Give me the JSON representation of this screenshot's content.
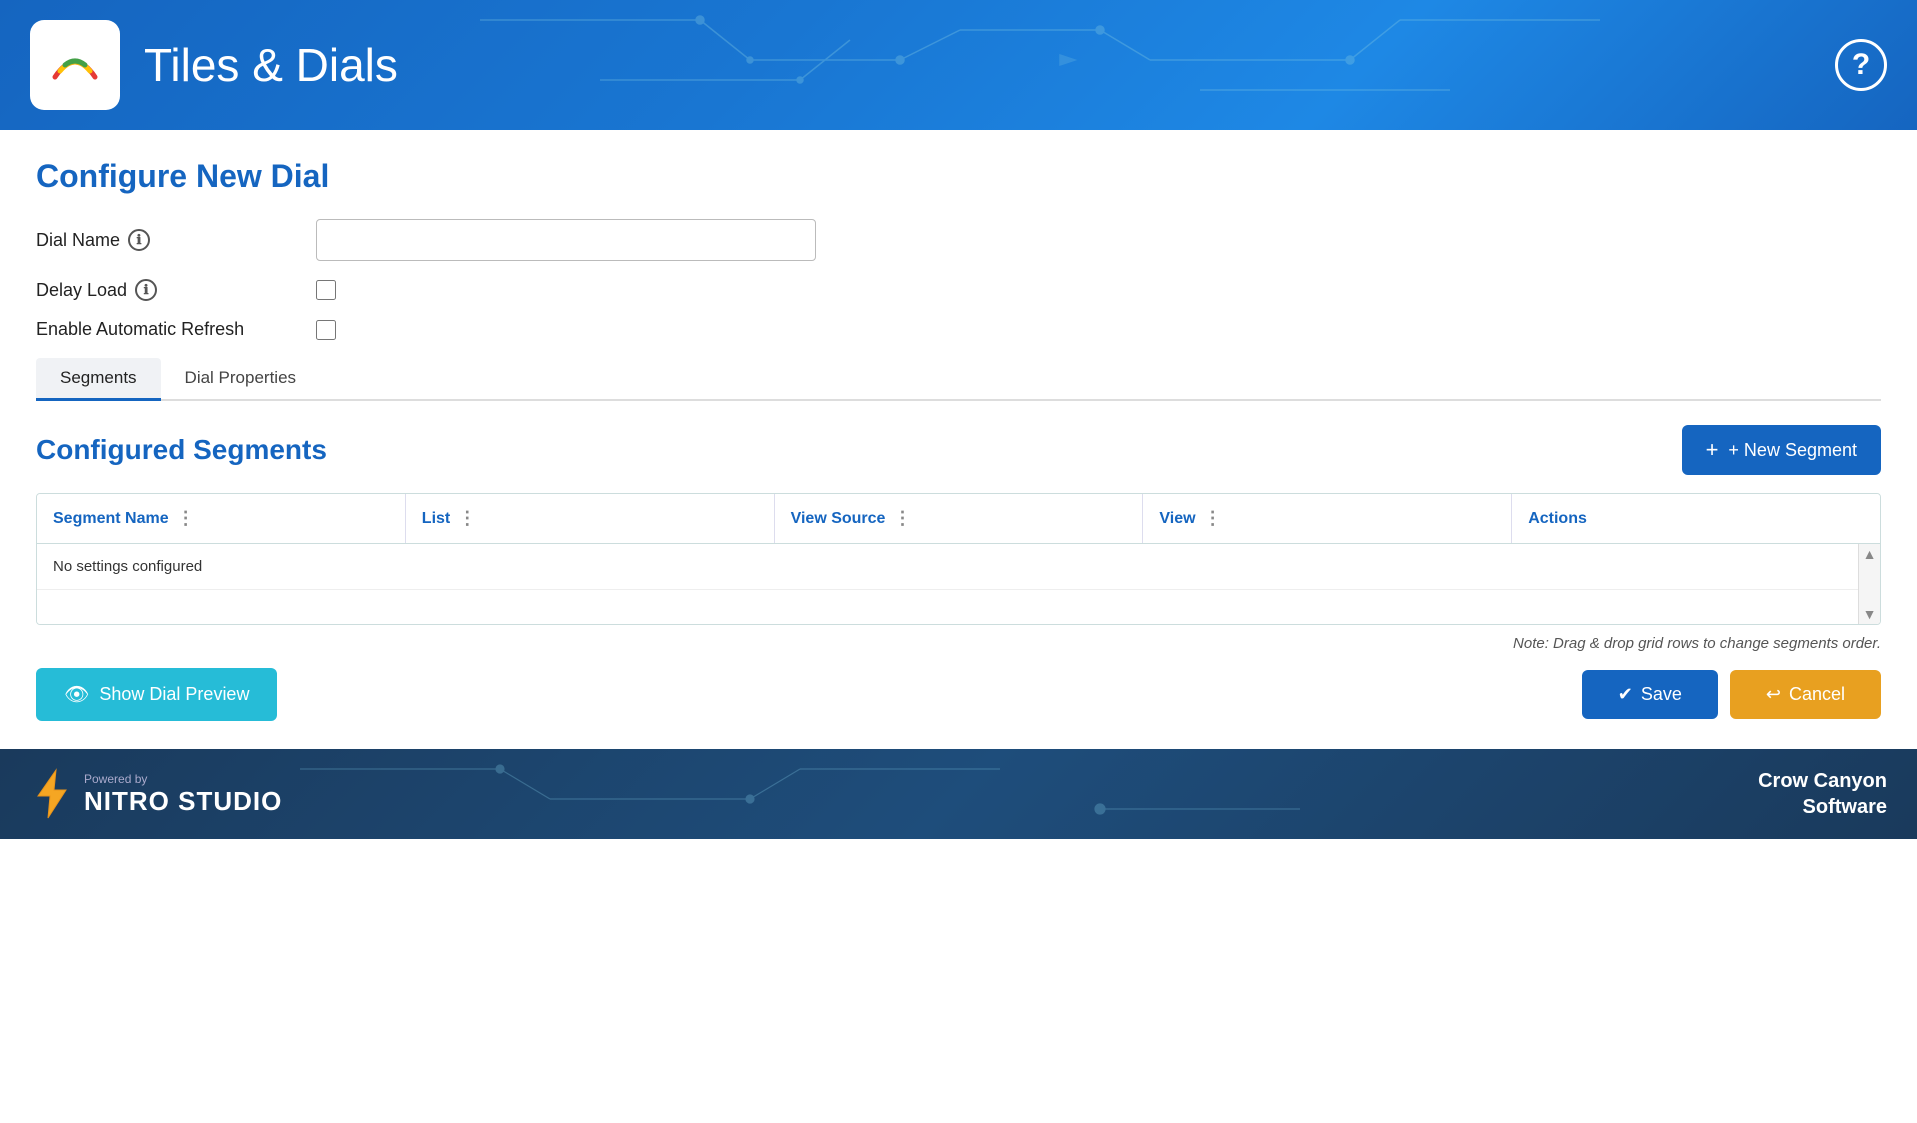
{
  "header": {
    "title": "Tiles & Dials",
    "help_label": "?",
    "logo_alt": "App Logo"
  },
  "page": {
    "configure_title": "Configure New Dial"
  },
  "form": {
    "dial_name_label": "Dial Name",
    "dial_name_placeholder": "",
    "delay_load_label": "Delay Load",
    "enable_refresh_label": "Enable Automatic Refresh",
    "info_icon": "ℹ"
  },
  "tabs": [
    {
      "id": "segments",
      "label": "Segments",
      "active": true
    },
    {
      "id": "dial-properties",
      "label": "Dial Properties",
      "active": false
    }
  ],
  "segments": {
    "title": "Configured Segments",
    "new_segment_button": "+ New Segment",
    "columns": [
      {
        "id": "segment-name",
        "label": "Segment Name"
      },
      {
        "id": "list",
        "label": "List"
      },
      {
        "id": "view-source",
        "label": "View Source"
      },
      {
        "id": "view",
        "label": "View"
      },
      {
        "id": "actions",
        "label": "Actions"
      }
    ],
    "empty_message": "No settings configured",
    "note": "Note: Drag & drop grid rows to change segments order."
  },
  "actions": {
    "show_preview_label": "Show Dial Preview",
    "save_label": "Save",
    "cancel_label": "Cancel",
    "preview_icon": "👁",
    "save_icon": "✔",
    "cancel_icon": "↩"
  },
  "footer": {
    "powered_by": "Powered by",
    "product": "NITRO STUDIO",
    "brand_line1": "Crow Canyon",
    "brand_line2": "Software"
  }
}
